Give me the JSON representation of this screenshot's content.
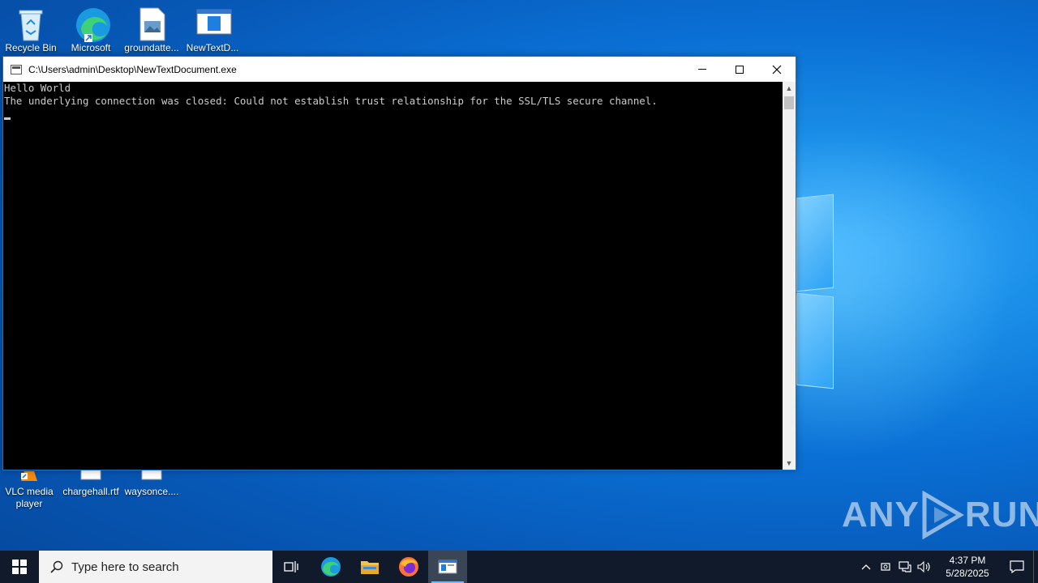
{
  "desktop": {
    "top_icons": [
      {
        "label": "Recycle Bin"
      },
      {
        "label": "Microsoft"
      },
      {
        "label": "groundatte..."
      },
      {
        "label": "NewTextD..."
      }
    ],
    "bottom_icons": [
      {
        "label": "VLC media player"
      },
      {
        "label": "chargehall.rtf"
      },
      {
        "label": "waysonce...."
      }
    ]
  },
  "console": {
    "title": "C:\\Users\\admin\\Desktop\\NewTextDocument.exe",
    "lines": [
      "Hello World",
      "The underlying connection was closed: Could not establish trust relationship for the SSL/TLS secure channel."
    ]
  },
  "taskbar": {
    "search_placeholder": "Type here to search",
    "time": "4:37 PM",
    "date": "5/28/2025"
  },
  "watermark": {
    "text_left": "ANY",
    "text_right": "RUN"
  },
  "colors": {
    "accent": "#0a6fd4",
    "taskbar": "#101a2a",
    "terminal_bg": "#000000",
    "terminal_fg": "#cccccc"
  }
}
